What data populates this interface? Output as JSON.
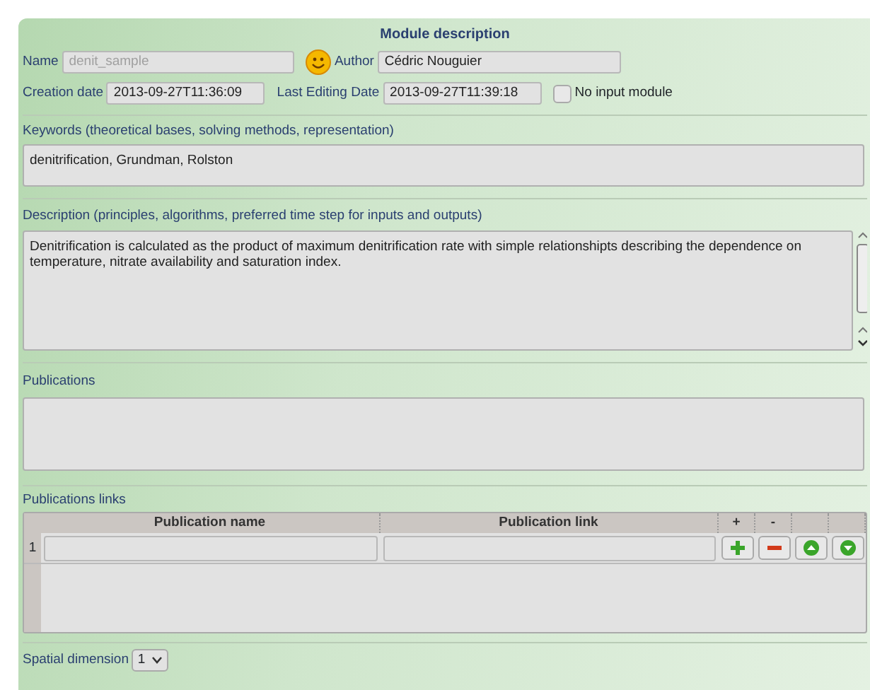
{
  "title": "Module description",
  "name": {
    "label": "Name",
    "value": "denit_sample",
    "disabled": true
  },
  "author": {
    "label": "Author",
    "value": "Cédric Nouguier"
  },
  "creation_date": {
    "label": "Creation date",
    "value": "2013-09-27T11:36:09"
  },
  "last_editing_date": {
    "label": "Last Editing Date",
    "value": "2013-09-27T11:39:18"
  },
  "no_input_module": {
    "label": "No input module",
    "checked": false
  },
  "keywords": {
    "label": "Keywords (theoretical bases, solving methods, representation)",
    "value": "denitrification, Grundman, Rolston"
  },
  "description": {
    "label": "Description (principles, algorithms, preferred time step for inputs and outputs)",
    "value": "Denitrification is calculated as the product of maximum denitrification rate with simple relationshipts describing the dependence on temperature, nitrate availability and saturation index."
  },
  "publications": {
    "label": "Publications"
  },
  "publications_links": {
    "label": "Publications links",
    "columns": [
      "Publication name",
      "Publication link",
      "+",
      "-"
    ],
    "rows": [
      {
        "index": "1"
      }
    ]
  },
  "spatial_dimension": {
    "label": "Spatial dimension",
    "value": "1"
  }
}
